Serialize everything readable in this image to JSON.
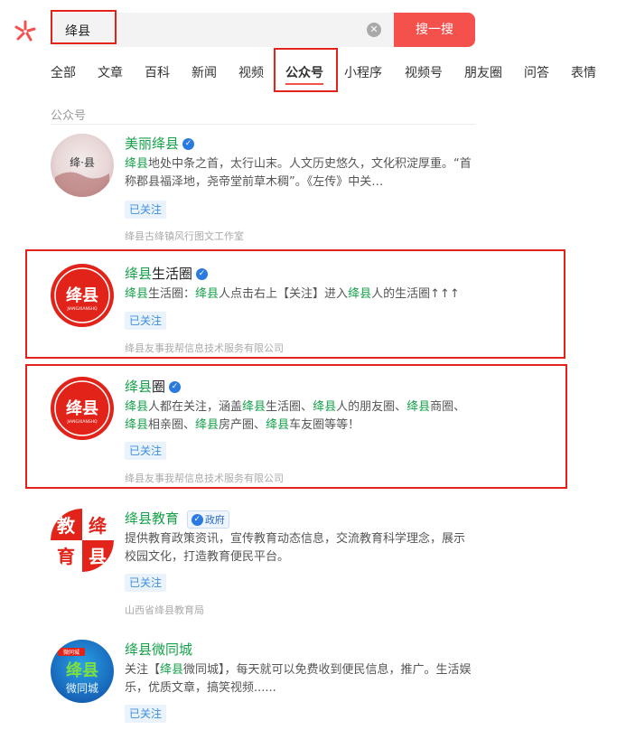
{
  "search": {
    "query": "绛县",
    "button_label": "搜一搜"
  },
  "tabs": [
    "全部",
    "文章",
    "百科",
    "新闻",
    "视频",
    "公众号",
    "小程序",
    "视频号",
    "朋友圈",
    "问答",
    "表情"
  ],
  "active_tab": "公众号",
  "section_label": "公众号",
  "accent_color": "#f4514d",
  "highlight_color": "#15a04a",
  "results": [
    {
      "title": "美丽绛县",
      "description": "绛县地处中条之首，太行山末。人文历史悠久，文化积淀厚重。“首称郡县福泽地，尧帝堂前草木稠”。《左传》中关…",
      "follow_label": "已关注",
      "source": "绛县古绛镇风行图文工作室",
      "avatar_text": "绛·县"
    },
    {
      "title": "绛县生活圈",
      "description": "绛县生活圈：绛县人点击右上【关注】进入绛县人的生活圈↑↑↑",
      "follow_label": "已关注",
      "source": "绛县友事我帮信息技术服务有限公司",
      "avatar_text": "绛县",
      "avatar_sub": "JIANGXIANSHQ"
    },
    {
      "title": "绛县圈",
      "description": "绛县人都在关注，涵盖绛县生活圈、绛县人的朋友圈、绛县商圈、绛县相亲圈、绛县房产圈、绛县车友圈等等！",
      "follow_label": "已关注",
      "source": "绛县友事我帮信息技术服务有限公司",
      "avatar_text": "绛县",
      "avatar_sub": "JIANGXIANSHQ"
    },
    {
      "title": "绛县教育",
      "badge": "政府",
      "description": "提供教育政策资讯，宣传教育动态信息，交流教育科学理念，展示校园文化，打造教育便民平台。",
      "follow_label": "已关注",
      "source": "山西省绛县教育局",
      "avatar_chars": [
        "教",
        "绛",
        "育",
        "县"
      ]
    },
    {
      "title": "绛县微同城",
      "description": "关注【绛县微同城】，每天就可以免费收到便民信息，推广。生活娱乐，优质文章，搞笑视频......",
      "follow_label": "已关注",
      "avatar_text": "绛县",
      "avatar_text2": "微同城",
      "avatar_tag": "微同城"
    }
  ]
}
